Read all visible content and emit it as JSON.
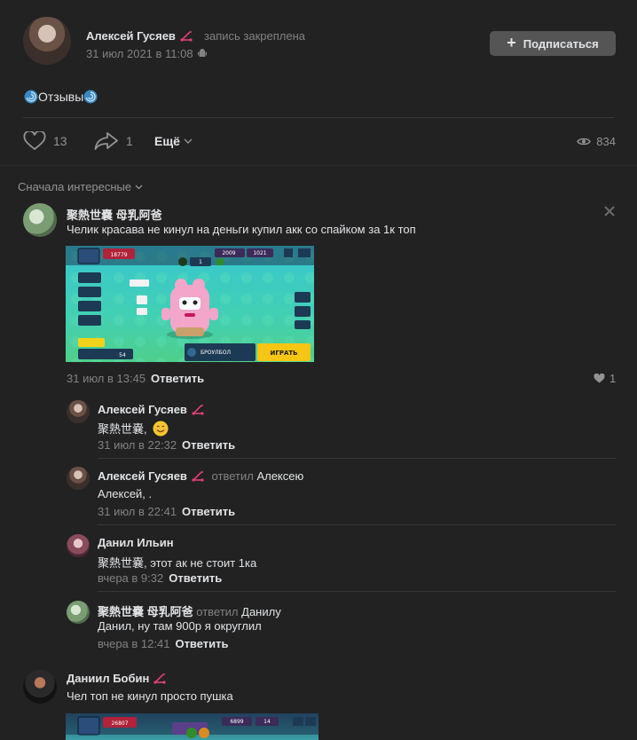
{
  "post": {
    "author": "Алексей Гусяев",
    "pinned_label": "запись закреплена",
    "date": "31 июл 2021 в 11:08",
    "subscribe_label": "Подписаться",
    "text": "Отзывы",
    "likes": "13",
    "shares": "1",
    "more_label": "Ещё",
    "views": "834"
  },
  "sort_label": "Сначала интересные",
  "comments": [
    {
      "author": "聚熱世嚢 母乳阿爸",
      "text": "Челик красава не кинул на деньги купил акк со спайком за 1к топ",
      "date": "31 июл в 13:45",
      "reply_label": "Ответить",
      "likes": "1",
      "screenshot": {
        "trophies": "18779",
        "gems": "2009",
        "coins": "1021",
        "brawler_level": "1",
        "mode_name": "БРОУЛБОЛ",
        "play_label": "ИГРАТЬ",
        "count": "54"
      }
    },
    {
      "author": "Алексей Гусяев",
      "text": "聚熱世嚢, ",
      "date": "31 июл в 22:32",
      "reply_label": "Ответить"
    },
    {
      "author": "Алексей Гусяев",
      "replied_label": "ответил",
      "replied_to": "Алексею",
      "text": "Алексей, .",
      "date": "31 июл в 22:41",
      "reply_label": "Ответить"
    },
    {
      "author": "Данил Ильин",
      "text": "聚熱世嚢, этот ак не стоит 1ка",
      "date": "вчера в 9:32",
      "reply_label": "Ответить"
    },
    {
      "author": "聚熱世嚢 母乳阿爸",
      "replied_label": "ответил",
      "replied_to": "Данилу",
      "text": "Данил, ну там 900р я округлил",
      "date": "вчера в 12:41",
      "reply_label": "Ответить"
    },
    {
      "author": "Даниил Бобин",
      "text": "Чел топ не кинул просто пушка",
      "screenshot": {
        "trophies": "26807",
        "gems": "6899",
        "coins": "14"
      }
    }
  ],
  "colors": {
    "background": "#222222",
    "text": "#e1e3e6",
    "muted": "#828282",
    "button": "#555555",
    "scooter": "#e0407a"
  }
}
